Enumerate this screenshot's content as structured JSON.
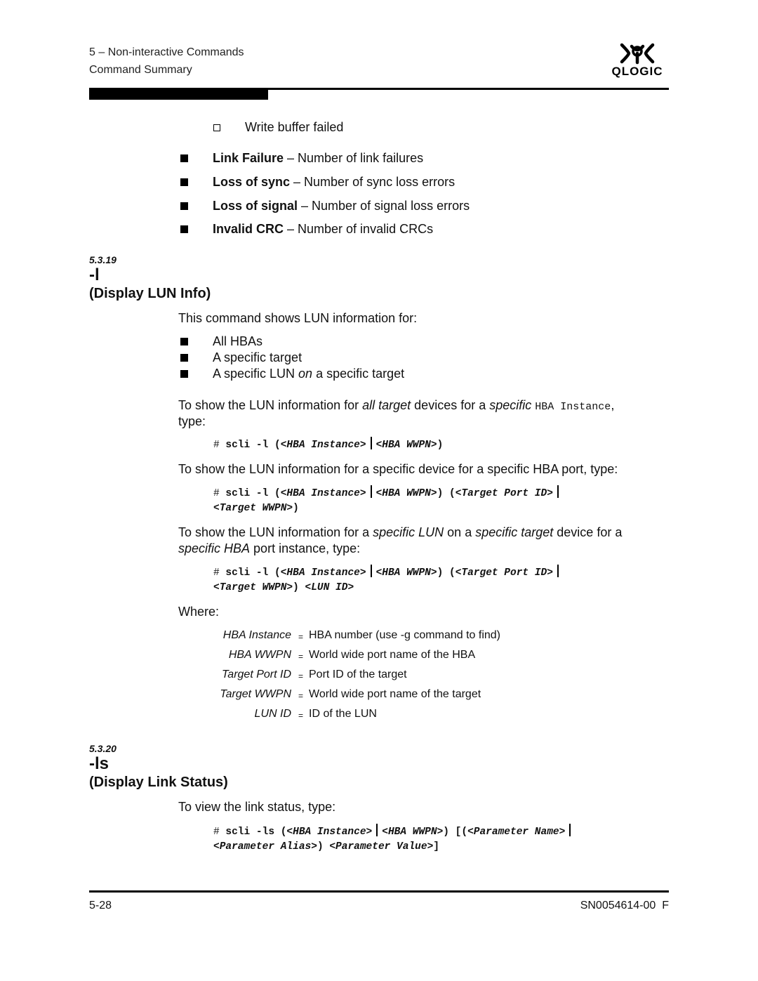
{
  "header": {
    "chapter": "5 – Non-interactive Commands",
    "section": "Command Summary",
    "logo_text": "QLOGIC",
    "logo_icon": "qlogic-logo-icon"
  },
  "top_list": {
    "sub_item": "Write buffer failed",
    "items": [
      {
        "term": "Link Failure",
        "desc": " – Number of link failures"
      },
      {
        "term": "Loss of sync",
        "desc": " – Number of sync loss errors"
      },
      {
        "term": "Loss of signal",
        "desc": " – Number of signal loss errors"
      },
      {
        "term": "Invalid CRC",
        "desc": " – Number of invalid CRCs"
      }
    ]
  },
  "section_5_3_19": {
    "number": "5.3.19",
    "command": "-l",
    "title": "(Display LUN Info)",
    "intro": "This command shows LUN information for:",
    "bullets": [
      {
        "text_before": "All HBAs",
        "em": "",
        "text_after": ""
      },
      {
        "text_before": "A specific target",
        "em": "",
        "text_after": ""
      },
      {
        "text_before": "A specific LUN ",
        "em": "on",
        "text_after": " a specific target"
      }
    ],
    "para1": {
      "t1": "To show the LUN information for ",
      "e1": "all target",
      "t2": " devices for a ",
      "e2": "specific",
      "t3": " ",
      "mono": "HBA Instance",
      "t4": ",",
      "t5": "type:"
    },
    "code1": {
      "hash": "# ",
      "cmd": "scli -l (",
      "a1": "<HBA Instance>",
      "a2": "<HBA WWPN>",
      "close": ")"
    },
    "para2": "To show the LUN information for a specific device for a specific HBA port, type:",
    "code2": {
      "hash": "# ",
      "cmd": "scli -l (",
      "a1": "<HBA Instance>",
      "a2": "<HBA WWPN>",
      "mid": ") (",
      "a3": "<Target Port ID>",
      "a4": "<Target WWPN>",
      "close": ")"
    },
    "para3": {
      "t1": "To show the LUN information for a ",
      "e1": "specific LUN",
      "t2": " on a ",
      "e2": "specific target",
      "t3": " device for a",
      "e3": "specific HBA",
      "t4": " port instance, type:"
    },
    "code3": {
      "hash": "# ",
      "cmd": "scli -l (",
      "a1": "<HBA Instance>",
      "a2": "<HBA WWPN>",
      "mid": ") (",
      "a3": "<Target Port ID>",
      "a4": "<Target WWPN>",
      "mid2": ") ",
      "a5": "<LUN ID>"
    },
    "where_label": "Where:",
    "definitions": [
      {
        "term": "HBA Instance",
        "eq": "=",
        "desc": "HBA number (use -g command to find)"
      },
      {
        "term": "HBA WWPN",
        "eq": "=",
        "desc": "World wide port name of the HBA"
      },
      {
        "term": "Target Port ID",
        "eq": "=",
        "desc": "Port ID of the target"
      },
      {
        "term": "Target WWPN",
        "eq": "=",
        "desc": "World wide port name of the target"
      },
      {
        "term": "LUN ID",
        "eq": "=",
        "desc": "ID of the LUN"
      }
    ]
  },
  "section_5_3_20": {
    "number": "5.3.20",
    "command": "-ls",
    "title": "(Display Link Status)",
    "intro": "To view the link status, type:",
    "code": {
      "hash": "# ",
      "cmd": "scli -ls (",
      "a1": "<HBA Instance>",
      "a2": "<HBA WWPN>",
      "mid": ") [(",
      "a3": "<Parameter Name>",
      "a4": "<Parameter Alias>",
      "mid2": ") ",
      "a5": "<Parameter Value>",
      "close": "]"
    }
  },
  "footer": {
    "page": "5-28",
    "doc_id": "SN0054614-00  F"
  }
}
